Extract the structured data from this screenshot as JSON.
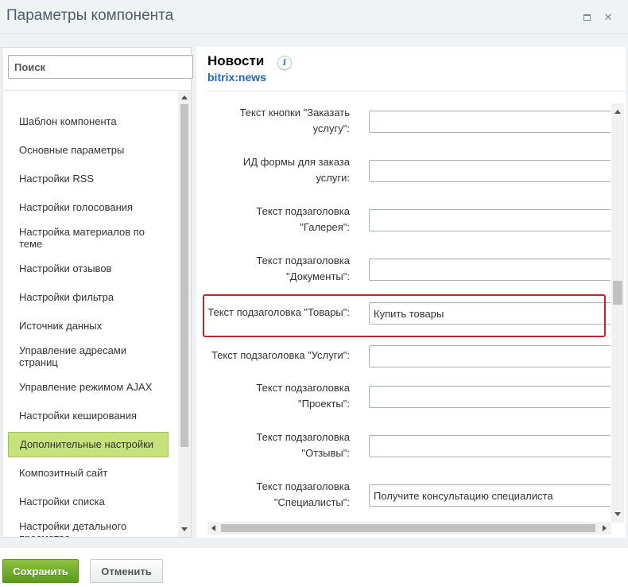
{
  "window": {
    "title": "Параметры компонента",
    "maximize_icon": "maximize-icon",
    "close_icon": "close-icon",
    "close_glyph": "✕"
  },
  "search": {
    "placeholder": "Поиск",
    "value": ""
  },
  "sidebar": {
    "items": [
      {
        "label": "Шаблон компонента"
      },
      {
        "label": "Основные параметры"
      },
      {
        "label": "Настройки RSS"
      },
      {
        "label": "Настройки голосования"
      },
      {
        "label": "Настройка материалов по теме"
      },
      {
        "label": "Настройки отзывов"
      },
      {
        "label": "Настройки фильтра"
      },
      {
        "label": "Источник данных"
      },
      {
        "label": "Управление адресами страниц"
      },
      {
        "label": "Управление режимом AJAX"
      },
      {
        "label": "Настройки кеширования"
      },
      {
        "label": "Дополнительные настройки",
        "active": true
      },
      {
        "label": "Композитный сайт"
      },
      {
        "label": "Настройки списка"
      },
      {
        "label": "Настройки детального просмотра"
      }
    ]
  },
  "component": {
    "name": "Новости",
    "info_icon": "info-icon",
    "info_glyph": "i",
    "code": "bitrix:news"
  },
  "form": {
    "fields": [
      {
        "label_lines": [
          "Текст кнопки \"Заказать",
          "услугу\":"
        ],
        "value": ""
      },
      {
        "label_lines": [
          "ИД формы для заказа",
          "услуги:"
        ],
        "value": ""
      },
      {
        "label_lines": [
          "Текст подзаголовка",
          "\"Галерея\":"
        ],
        "value": ""
      },
      {
        "label_lines": [
          "Текст подзаголовка",
          "\"Документы\":"
        ],
        "value": ""
      },
      {
        "label_lines": [
          "Текст подзаголовка \"Товары\":"
        ],
        "value": "Купить товары",
        "highlighted": true
      },
      {
        "label_lines": [
          "Текст подзаголовка \"Услуги\":"
        ],
        "value": ""
      },
      {
        "label_lines": [
          "Текст подзаголовка",
          "\"Проекты\":"
        ],
        "value": ""
      },
      {
        "label_lines": [
          "Текст подзаголовка",
          "\"Отзывы\":"
        ],
        "value": ""
      },
      {
        "label_lines": [
          "Текст подзаголовка",
          "\"Специалисты\":"
        ],
        "value": "Получите консультацию специалиста"
      }
    ]
  },
  "footer": {
    "save_label": "Сохранить",
    "cancel_label": "Отменить"
  },
  "colors": {
    "accent_green": "#5b9b1f",
    "active_item_bg": "#c7e17c",
    "highlight_border": "#c0262e",
    "link_blue": "#2067b0"
  }
}
